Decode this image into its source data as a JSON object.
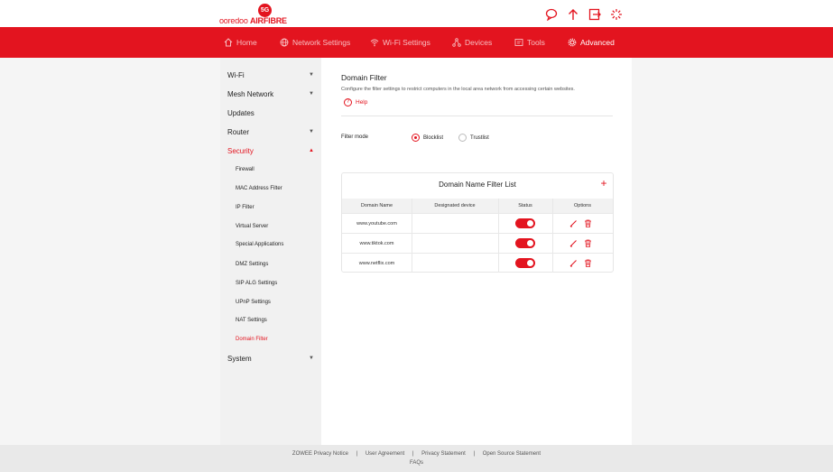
{
  "brand": {
    "logo_badge": "5G",
    "logo_name": "ooredoo",
    "logo_product": "AIRFIBRE",
    "accent": "#e3141f"
  },
  "header_icons": [
    "chat-icon",
    "upload-icon",
    "logout-icon",
    "loading-icon"
  ],
  "nav": {
    "items": [
      {
        "label": "Home",
        "icon": "home-icon"
      },
      {
        "label": "Network Settings",
        "icon": "globe-icon"
      },
      {
        "label": "Wi-Fi Settings",
        "icon": "wifi-icon"
      },
      {
        "label": "Devices",
        "icon": "devices-icon"
      },
      {
        "label": "Tools",
        "icon": "tools-icon"
      },
      {
        "label": "Advanced",
        "icon": "gear-icon",
        "active": true
      }
    ]
  },
  "sidebar": {
    "items": [
      {
        "label": "Wi-Fi",
        "caret": "▼"
      },
      {
        "label": "Mesh Network",
        "caret": "▼"
      },
      {
        "label": "Updates"
      },
      {
        "label": "Router",
        "caret": "▼"
      },
      {
        "label": "Security",
        "caret": "▲",
        "open": true
      },
      {
        "label": "System",
        "caret": "▼"
      }
    ],
    "security_sub": [
      "Firewall",
      "MAC Address Filter",
      "IP Filter",
      "Virtual Server",
      "Special Applications",
      "DMZ Settings",
      "SIP ALG Settings",
      "UPnP Settings",
      "NAT Settings",
      "Domain Filter"
    ],
    "active_sub": "Domain Filter"
  },
  "main": {
    "title": "Domain Filter",
    "description": "Configure the filter settings to restrict computers in the local area network from accessing certain websites.",
    "help_label": "Help",
    "help_symbol": "?",
    "filter_mode_label": "Filter mode",
    "filter_modes": [
      {
        "label": "Blocklist",
        "checked": true
      },
      {
        "label": "Trustlist",
        "checked": false
      }
    ],
    "table": {
      "title": "Domain Name Filter List",
      "add_symbol": "+",
      "columns": [
        "Domain Name",
        "Designated device",
        "Status",
        "Options"
      ],
      "rows": [
        {
          "domain": "www.youtube.com",
          "device": "",
          "status": "on"
        },
        {
          "domain": "www.tiktok.com",
          "device": "",
          "status": "on"
        },
        {
          "domain": "www.netflix.com",
          "device": "",
          "status": "on"
        }
      ]
    }
  },
  "footer": {
    "links": [
      "ZOWEE Privacy Notice",
      "User Agreement",
      "Privacy Statement",
      "Open Source Statement"
    ],
    "separator": "|",
    "faq": "FAQs"
  }
}
